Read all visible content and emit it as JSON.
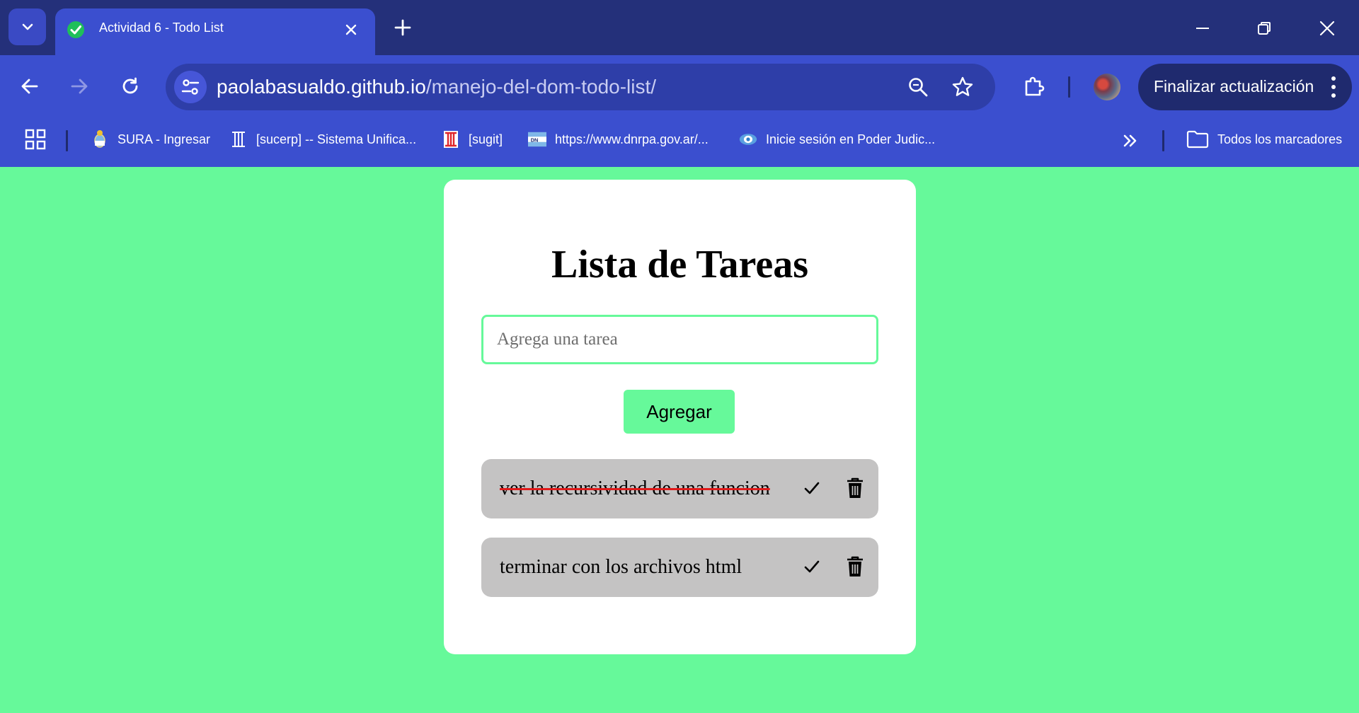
{
  "browser": {
    "tab": {
      "title": "Actividad 6 - Todo List"
    },
    "url": {
      "host": "paolabasualdo.github.io",
      "path": "/manejo-del-dom-todo-list/"
    },
    "update_button": {
      "label": "Finalizar actualización"
    },
    "bookmarks": [
      {
        "label": "SURA - Ingresar",
        "icon": "argentina-coat-of-arms-icon"
      },
      {
        "label": "[sucerp] -- Sistema Unifica...",
        "icon": "column-icon"
      },
      {
        "label": "[sugit]",
        "icon": "red-column-icon"
      },
      {
        "label": "https://www.dnrpa.gov.ar/...",
        "icon": "dnrpa-flag-icon"
      },
      {
        "label": "Inicie sesión en Poder Judic...",
        "icon": "poder-judicial-icon"
      }
    ],
    "all_bookmarks": {
      "label": "Todos los marcadores"
    }
  },
  "page": {
    "title": "Lista de Tareas",
    "input": {
      "placeholder": "Agrega una tarea",
      "value": ""
    },
    "add_button": {
      "label": "Agregar"
    },
    "tasks": [
      {
        "text": "ver la recursividad de una funcion",
        "completed": true
      },
      {
        "text": "terminar con los archivos html",
        "completed": false
      }
    ]
  },
  "colors": {
    "page_background": "#66f99a",
    "card": "#ffffff",
    "task_background": "#c4c3c3",
    "strikethrough": "#e01a1a",
    "browser_frame": "#24307a",
    "browser_toolbar": "#3b4fcf"
  }
}
